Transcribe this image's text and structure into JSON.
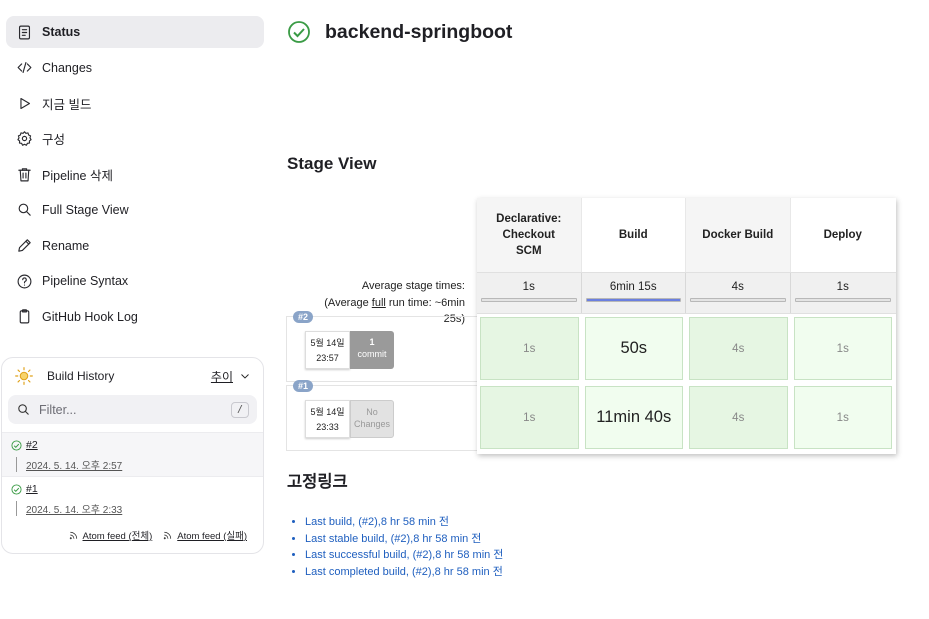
{
  "sidebar": {
    "items": [
      {
        "label": "Status",
        "icon": "document-icon",
        "active": true
      },
      {
        "label": "Changes",
        "icon": "code-icon"
      },
      {
        "label": "지금 빌드",
        "icon": "play-icon"
      },
      {
        "label": "구성",
        "icon": "gear-icon"
      },
      {
        "label": "Pipeline 삭제",
        "icon": "trash-icon"
      },
      {
        "label": "Full Stage View",
        "icon": "search-icon"
      },
      {
        "label": "Rename",
        "icon": "pencil-icon"
      },
      {
        "label": "Pipeline Syntax",
        "icon": "help-icon"
      },
      {
        "label": "GitHub Hook Log",
        "icon": "clipboard-icon"
      }
    ]
  },
  "build_history": {
    "title": "Build History",
    "trend": "추이",
    "filter_placeholder": "Filter...",
    "filter_shortcut": "/",
    "builds": [
      {
        "number": "#2",
        "date": "2024. 5. 14. 오후 2:57",
        "status": "success"
      },
      {
        "number": "#1",
        "date": "2024. 5. 14. 오후 2:33",
        "status": "success"
      }
    ],
    "feeds": {
      "all": "Atom feed (전체)",
      "failed": "Atom feed (실패)"
    }
  },
  "header": {
    "title": "backend-springboot",
    "status": "success"
  },
  "stage_view": {
    "title": "Stage View",
    "avg_label_1": "Average stage times:",
    "avg_label_2a": "(Average ",
    "avg_label_2b": "full",
    "avg_label_2c": " run time: ~6min",
    "avg_label_3": "25s)",
    "stages": [
      {
        "name_lines": [
          "Declarative:",
          "Checkout",
          "SCM"
        ],
        "avg": "1s",
        "avg_fraction": 0
      },
      {
        "name_lines": [
          "Build"
        ],
        "avg": "6min 15s",
        "avg_fraction": 1.0
      },
      {
        "name_lines": [
          "Docker Build"
        ],
        "avg": "4s",
        "avg_fraction": 0
      },
      {
        "name_lines": [
          "Deploy"
        ],
        "avg": "1s",
        "avg_fraction": 0
      }
    ],
    "runs": [
      {
        "badge": "#2",
        "date": "5월 14일",
        "time": "23:57",
        "commit_count": "1",
        "commit_label": "commit",
        "durations": [
          "1s",
          "50s",
          "4s",
          "1s"
        ]
      },
      {
        "badge": "#1",
        "date": "5월 14일",
        "time": "23:33",
        "commit_count": "No",
        "commit_label": "Changes",
        "durations": [
          "1s",
          "11min 40s",
          "4s",
          "1s"
        ]
      }
    ]
  },
  "permalinks": {
    "title": "고정링크",
    "items": [
      "Last build, (#2),8 hr 58 min 전",
      "Last stable build, (#2),8 hr 58 min 전",
      "Last successful build, (#2),8 hr 58 min 전",
      "Last completed build, (#2),8 hr 58 min 전"
    ]
  },
  "colors": {
    "success": "#3a9b45",
    "link": "#1f5fbf",
    "progress": "#6b7fe0",
    "stage_ok_dark": "#e6f6e3",
    "stage_ok_light": "#f1fdef"
  }
}
